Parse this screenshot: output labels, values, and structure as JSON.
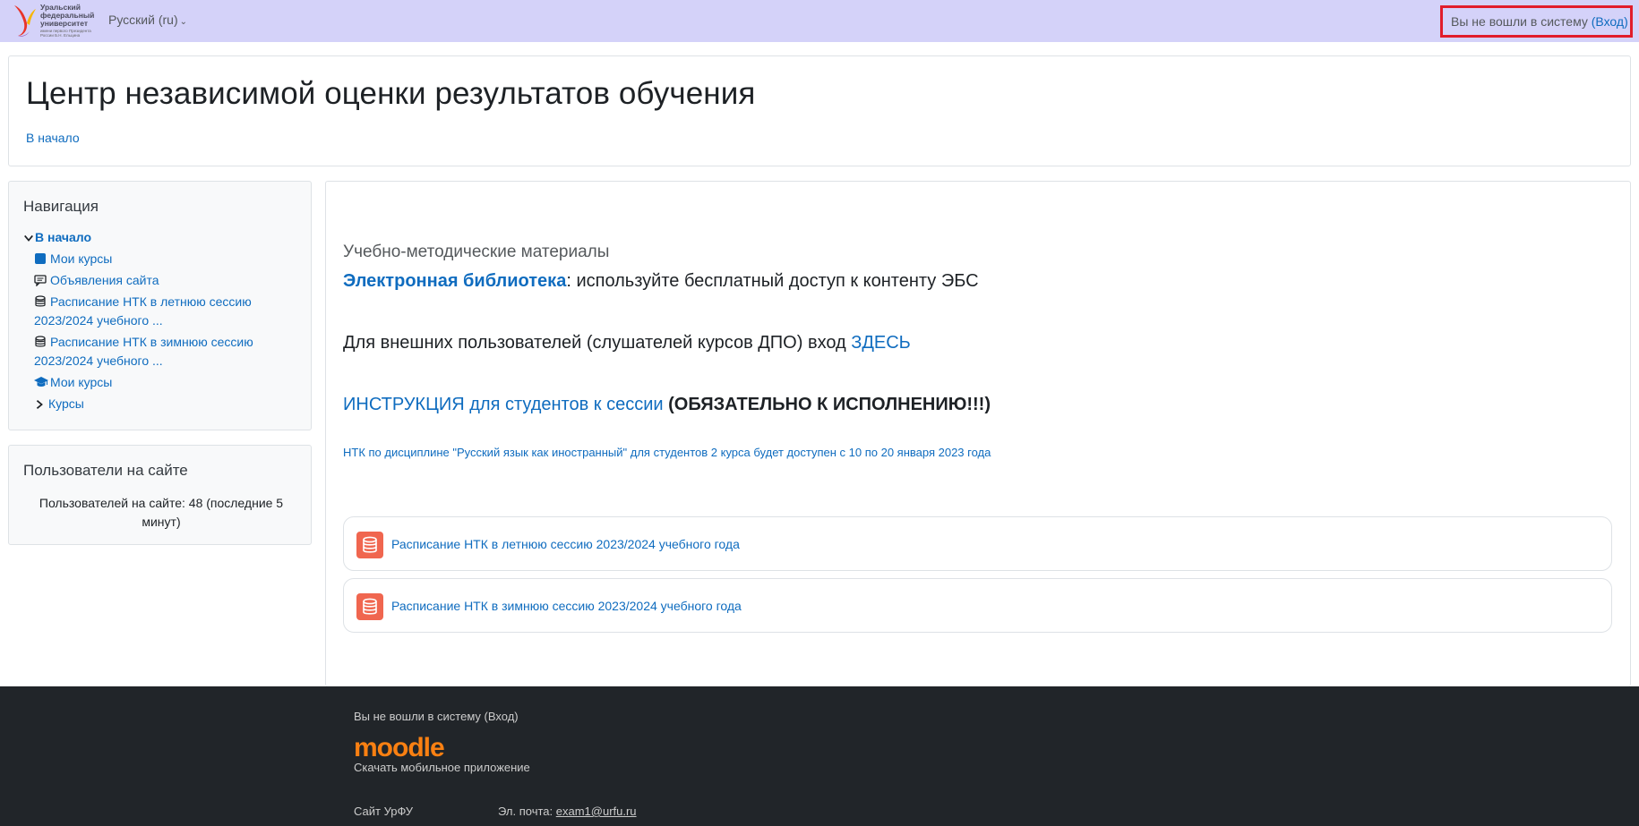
{
  "navbar": {
    "logo_text": "Уральский федеральный университет",
    "logo_subtext": "имени первого Президента России Б.Н. Ельцина",
    "language": "Русский (ru)",
    "login_status": "Вы не вошли в систему",
    "login_link": "(Вход)"
  },
  "header": {
    "title": "Центр независимой оценки результатов обучения",
    "breadcrumb_home": "В начало"
  },
  "navigation": {
    "title": "Навигация",
    "root": "В начало",
    "items": [
      {
        "label": "Мои курсы",
        "icon": "square-icon"
      },
      {
        "label": "Объявления сайта",
        "icon": "forum-icon"
      },
      {
        "label": "Расписание НТК в летнюю сессию 2023/2024 учебного ...",
        "icon": "database-icon"
      },
      {
        "label": "Расписание НТК в зимнюю сессию 2023/2024 учебного ...",
        "icon": "database-icon"
      },
      {
        "label": "Мои курсы",
        "icon": "graduation-cap-icon"
      },
      {
        "label": "Курсы",
        "icon": "chevron-right-icon"
      }
    ]
  },
  "online_users": {
    "title": "Пользователи на сайте",
    "text": "Пользователей на сайте: 48 (последние 5 минут)"
  },
  "main": {
    "section_title": "Учебно-методические материалы",
    "library_link": "Электронная библиотека",
    "library_text": ": используйте бесплатный доступ к контенту ЭБС",
    "external_text": "Для внешних пользователей (слушателей курсов ДПО) вход ",
    "external_link": "ЗДЕСЬ",
    "instruction_link": "ИНСТРУКЦИЯ для студентов к сессии",
    "instruction_bold": "(ОБЯЗАТЕЛЬНО К ИСПОЛНЕНИЮ!!!)",
    "ntk_notice": "НТК по дисциплине \"Русский язык как иностранный\" для студентов 2 курса будет доступен с 10 по 20 января 2023 года",
    "activities": [
      {
        "label": "Расписание НТК в летнюю сессию 2023/2024 учебного года",
        "icon": "database-icon"
      },
      {
        "label": "Расписание НТК в зимнюю сессию 2023/2024 учебного года",
        "icon": "database-icon"
      }
    ]
  },
  "footer": {
    "login_status": "Вы не вошли в систему (Вход)",
    "logo": "moodle",
    "app_text": "Скачать мобильное приложение",
    "site_link": "Сайт УрФУ",
    "email_label": "Эл. почта: ",
    "email": "exam1@urfu.ru"
  },
  "colors": {
    "navbar_bg": "#d4d2f9",
    "link": "#0f6cbf",
    "highlight_border": "#e11d2b",
    "footer_bg": "#212529",
    "activity_icon_bg": "#f0664f",
    "moodle_orange": "#f98012"
  }
}
